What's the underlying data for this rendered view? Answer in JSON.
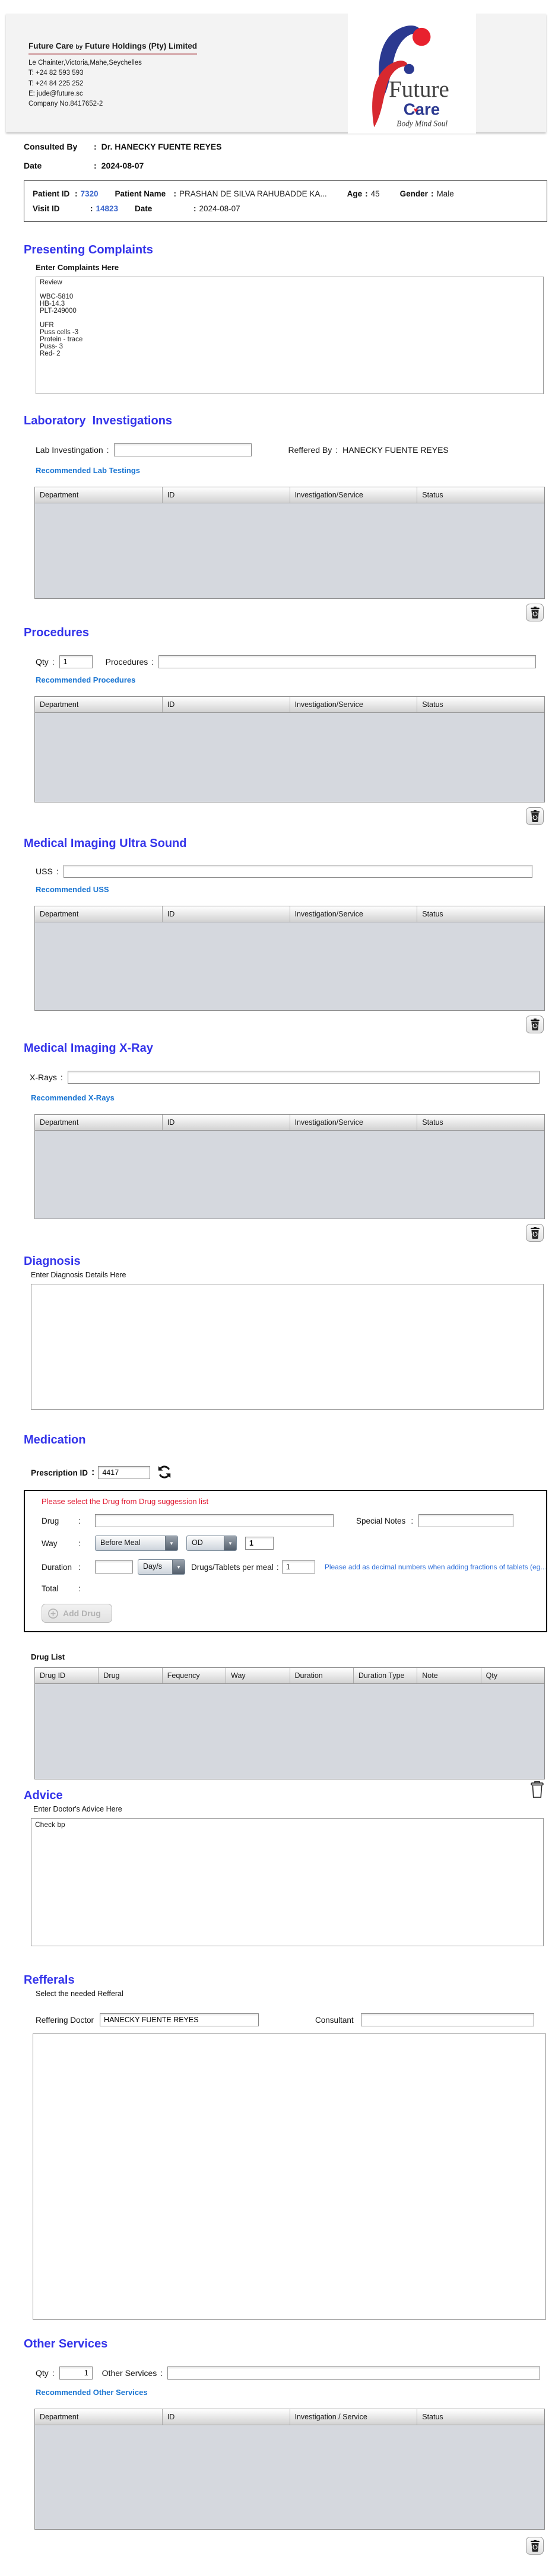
{
  "ui": {
    "colon": ":"
  },
  "letterhead": {
    "company_title_main": "Future Care",
    "company_title_by": "by",
    "company_title_rest": "Future Holdings (Pty) Limited",
    "address": [
      "Le Chainter,Victoria,Mahe,Seychelles",
      "T: +24  82 593 593",
      "T: +24  84 225 252",
      "E: jude@future.sc",
      "Company No.8417652-2"
    ],
    "logo": {
      "line1": "Future",
      "line2": "Care",
      "tagline": "Body Mind Soul"
    }
  },
  "consult": {
    "consulted_by_label": "Consulted By",
    "consulted_by_value": "Dr.  HANECKY FUENTE REYES",
    "date_label": "Date",
    "date_value": "2024-08-07"
  },
  "patient": {
    "patient_id_label": "Patient ID",
    "patient_id": "7320",
    "patient_name_label": "Patient Name",
    "patient_name": "PRASHAN DE SILVA RAHUBADDE KA...",
    "age_label": "Age",
    "age": "45",
    "gender_label": "Gender",
    "gender": "Male",
    "visit_id_label": "Visit ID",
    "visit_id": "14823",
    "visit_date_label": "Date",
    "visit_date": "2024-08-07"
  },
  "presenting_complaints": {
    "heading": "Presenting Complaints",
    "label": "Enter Complaints Here",
    "text": "Review\n\nWBC-5810\nHB-14.3\nPLT-249000\n\nUFR\nPuss cells -3\nProtein - trace\nPuss- 3\nRed- 2"
  },
  "lab": {
    "heading": "Laboratory  Investigations",
    "input_label": "Lab Investingation",
    "input_value": "",
    "referred_by_label": "Reffered By",
    "referred_by_value": "HANECKY FUENTE REYES",
    "link": "Recommended Lab Testings",
    "columns": [
      "Department",
      "ID",
      "Investigation/Service",
      "Status"
    ]
  },
  "procedures": {
    "heading": "Procedures",
    "qty_label": "Qty",
    "qty_value": "1",
    "input_label": "Procedures",
    "input_value": "",
    "link": "Recommended Procedures",
    "columns": [
      "Department",
      "ID",
      "Investigation/Service",
      "Status"
    ]
  },
  "uss": {
    "heading": "Medical Imaging Ultra Sound",
    "input_label": "USS",
    "input_value": "",
    "link": "Recommended USS",
    "columns": [
      "Department",
      "ID",
      "Investigation/Service",
      "Status"
    ]
  },
  "xray": {
    "heading": "Medical Imaging X-Ray",
    "input_label": "X-Rays",
    "input_value": "",
    "link": "Recommended X-Rays",
    "columns": [
      "Department",
      "ID",
      "Investigation/Service",
      "Status"
    ]
  },
  "diagnosis": {
    "heading": "Diagnosis",
    "label": "Enter Diagnosis Details Here",
    "text": ""
  },
  "medication": {
    "heading": "Medication",
    "prescription_id_label": "Prescription ID",
    "prescription_id": "4417",
    "warning": "Please select the Drug from Drug suggession list",
    "drug_label": "Drug",
    "drug_value": "",
    "special_notes_label": "Special Notes",
    "special_notes_value": "",
    "way_label": "Way",
    "way_value": "Before Meal",
    "frequency_value": "OD",
    "way_qty": "1",
    "duration_label": "Duration",
    "duration_value": "",
    "duration_type_value": "Day/s",
    "per_meal_label": "Drugs/Tablets per meal",
    "per_meal_value": "1",
    "note": "Please add as decimal numbers when adding fractions of tablets (eg...",
    "total_label": "Total",
    "add_drug_label": "Add Drug",
    "drug_list_label": "Drug List",
    "drug_list_columns": [
      "Drug ID",
      "Drug",
      "Fequency",
      "Way",
      "Duration",
      "Duration Type",
      "Note",
      "Qty"
    ]
  },
  "advice": {
    "heading": "Advice",
    "label": "Enter Doctor's Advice Here",
    "text": "Check bp"
  },
  "referrals": {
    "heading": "Refferals",
    "label": "Select the needed Refferal",
    "doctor_label": "Reffering Doctor",
    "doctor_value": "HANECKY FUENTE REYES",
    "consultant_label": "Consultant",
    "consultant_value": ""
  },
  "other_services": {
    "heading": "Other Services",
    "qty_label": "Qty",
    "qty_value": "1",
    "input_label": "Other Services",
    "input_value": "",
    "link": "Recommended Other Services",
    "columns": [
      "Department",
      "ID",
      "Investigation / Service",
      "Status"
    ]
  }
}
